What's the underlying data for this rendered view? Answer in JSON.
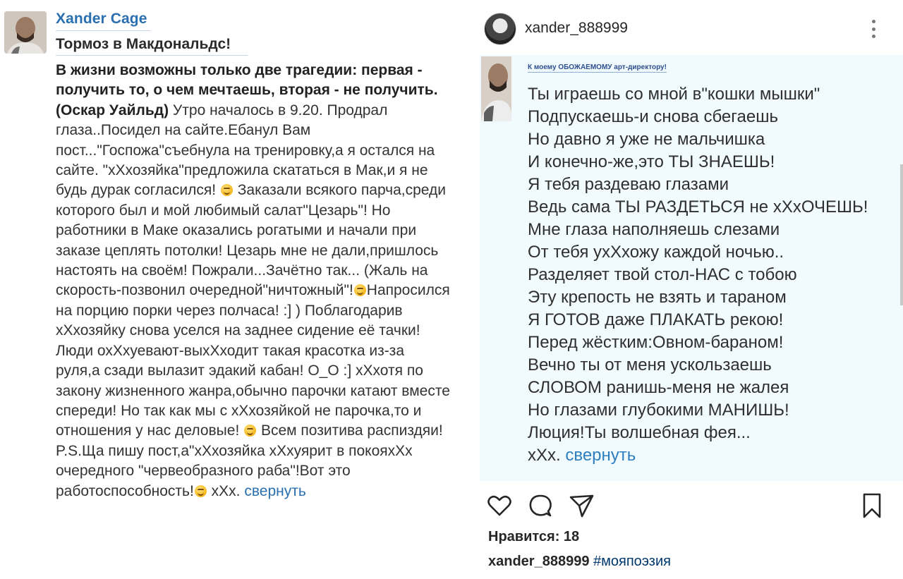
{
  "vk_post": {
    "author_name": "Xander Cage",
    "title": "Тормоз в Макдональдс!",
    "quote_bold": "В жизни возможны только две трагедии: первая - получить то, о чем мечтаешь, вторая - не получить. (Оскар Уайльд)",
    "text_1": " Утро началось в 9.20. Продрал глаза..Посидел на сайте.Ебанул Вам пост...\"Госпожа\"съебнула на тренировку,а я остался на сайте. \"хХхозяйка\"предложила скататься в Мак,и я не будь дурак согласился! ",
    "text_2": " Заказали всякого парча,среди которого был и мой любимый салат\"Цезарь\"! Но работники в Маке оказались рогатыми и начали при заказе цеплять потолки! Цезарь мне не дали,пришлось настоять на своём! Пожрали...Зачётно так... (Жаль на скорость-позвонил очередной\"ничтожный\"!",
    "text_3": "Напросился на порцию порки через полчаса! :] ) Поблагодарив хХхозяйку снова уселся на заднее сидение её тачки! Люди охХхуевают-выхХходит такая красотка из-за руля,а сзади вылазит эдакий кабан! О_О :] хХхотя по закону жизненного жанра,обычно парочки катают вместе спереди! Но так как мы с хХхозяйкой не парочка,то и отношения у нас деловые! ",
    "text_4": " Всем позитива распиздяи! P.S.Ща пишу пост,а\"хХхозяйка хХхуярит в покояхХх очередного \"червеобразного раба\"!Вот это работоспособность!",
    "text_5": " хХх. ",
    "collapse_link": "свернуть",
    "emoji_icon": "smile-emoji"
  },
  "ig_post": {
    "username": "xander_888999",
    "image": {
      "header": "К моему ОБОЖАЕМОМУ арт-директору!",
      "poem_lines": [
        "Ты играешь со мной в\"кошки мышки\"",
        "Подпускаешь-и снова сбегаешь",
        "Но давно я уже не мальчишка",
        "И конечно-же,это ТЫ ЗНАЕШЬ!",
        "Я тебя раздеваю глазами",
        "Ведь сама ТЫ РАЗДЕТЬСЯ не хХхОЧЕШЬ!",
        "Мне глаза наполняешь слезами",
        "От тебя ухХхожу каждой ночью..",
        "Разделяет твой стол-НАС с тобою",
        "Эту крепость не взять и тараном",
        "Я ГОТОВ даже ПЛАКАТЬ рекою!",
        "Перед жёстким:Овном-бараном!",
        "Вечно ты от меня ускользаешь",
        "СЛОВОМ ранишь-меня не жалея",
        "Но глазами глубокими МАНИШЬ!",
        "Люция!Ты волшебная фея..."
      ],
      "last_line_prefix": "хХх. ",
      "collapse_link": "свернуть"
    },
    "actions": {
      "like_icon": "heart-icon",
      "comment_icon": "comment-icon",
      "share_icon": "send-icon",
      "save_icon": "bookmark-icon"
    },
    "likes_label": "Нравится: 18",
    "caption_user": "xander_888999",
    "caption_hashtag": "#мояпоэзия"
  }
}
